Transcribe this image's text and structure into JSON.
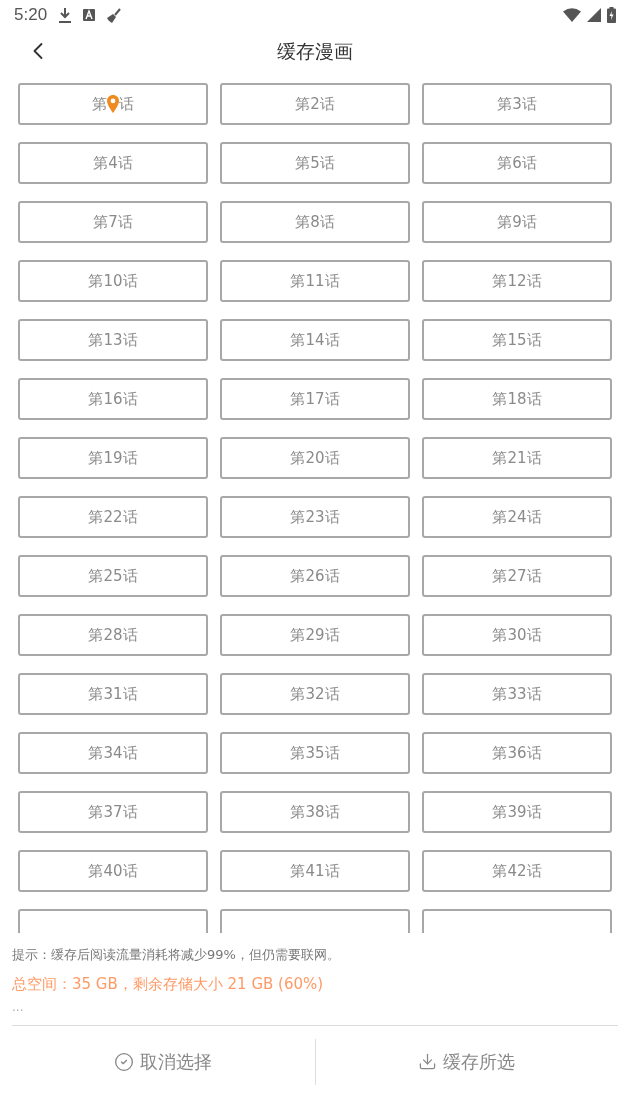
{
  "status_bar": {
    "time": "5:20"
  },
  "header": {
    "title": "缓存漫画"
  },
  "chapters": [
    {
      "kind": "current",
      "before": "第",
      "after": "话"
    },
    {
      "kind": "plain",
      "label": "第2话"
    },
    {
      "kind": "plain",
      "label": "第3话"
    },
    {
      "kind": "plain",
      "label": "第4话"
    },
    {
      "kind": "plain",
      "label": "第5话"
    },
    {
      "kind": "plain",
      "label": "第6话"
    },
    {
      "kind": "plain",
      "label": "第7话"
    },
    {
      "kind": "plain",
      "label": "第8话"
    },
    {
      "kind": "plain",
      "label": "第9话"
    },
    {
      "kind": "plain",
      "label": "第10话"
    },
    {
      "kind": "plain",
      "label": "第11话"
    },
    {
      "kind": "plain",
      "label": "第12话"
    },
    {
      "kind": "plain",
      "label": "第13话"
    },
    {
      "kind": "plain",
      "label": "第14话"
    },
    {
      "kind": "plain",
      "label": "第15话"
    },
    {
      "kind": "plain",
      "label": "第16话"
    },
    {
      "kind": "plain",
      "label": "第17话"
    },
    {
      "kind": "plain",
      "label": "第18话"
    },
    {
      "kind": "plain",
      "label": "第19话"
    },
    {
      "kind": "plain",
      "label": "第20话"
    },
    {
      "kind": "plain",
      "label": "第21话"
    },
    {
      "kind": "plain",
      "label": "第22话"
    },
    {
      "kind": "plain",
      "label": "第23话"
    },
    {
      "kind": "plain",
      "label": "第24话"
    },
    {
      "kind": "plain",
      "label": "第25话"
    },
    {
      "kind": "plain",
      "label": "第26话"
    },
    {
      "kind": "plain",
      "label": "第27话"
    },
    {
      "kind": "plain",
      "label": "第28话"
    },
    {
      "kind": "plain",
      "label": "第29话"
    },
    {
      "kind": "plain",
      "label": "第30话"
    },
    {
      "kind": "plain",
      "label": "第31话"
    },
    {
      "kind": "plain",
      "label": "第32话"
    },
    {
      "kind": "plain",
      "label": "第33话"
    },
    {
      "kind": "plain",
      "label": "第34话"
    },
    {
      "kind": "plain",
      "label": "第35话"
    },
    {
      "kind": "plain",
      "label": "第36话"
    },
    {
      "kind": "plain",
      "label": "第37话"
    },
    {
      "kind": "plain",
      "label": "第38话"
    },
    {
      "kind": "plain",
      "label": "第39话"
    },
    {
      "kind": "plain",
      "label": "第40话"
    },
    {
      "kind": "plain",
      "label": "第41话"
    },
    {
      "kind": "plain",
      "label": "第42话"
    }
  ],
  "footer": {
    "hint": "提示：缓存后阅读流量消耗将减少99%，但仍需要联网。",
    "storage": "总空间：35 GB，剩余存储大小 21 GB (60%)",
    "more": "..."
  },
  "actions": [
    {
      "kind": "deselect",
      "label": "取消选择"
    },
    {
      "kind": "download",
      "label": "缓存所选"
    }
  ]
}
